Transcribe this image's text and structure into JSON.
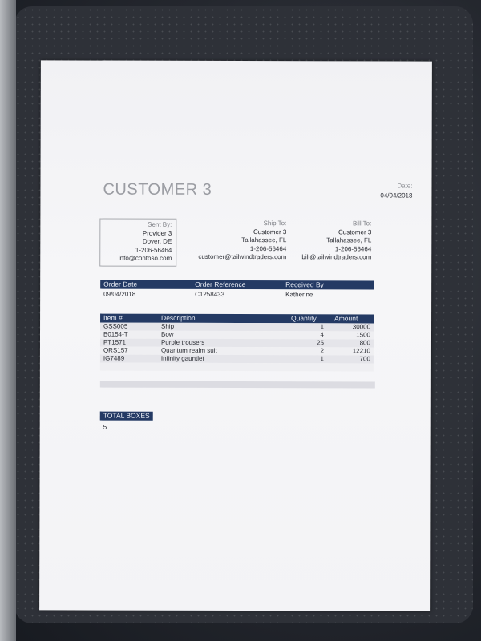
{
  "document": {
    "title": "CUSTOMER 3",
    "date_label": "Date:",
    "date_value": "04/04/2018"
  },
  "sent_by": {
    "label": "Sent By:",
    "name": "Provider 3",
    "city": "Dover, DE",
    "phone": "1-206-56464",
    "email": "info@contoso.com"
  },
  "ship_to": {
    "label": "Ship To:",
    "name": "Customer 3",
    "city": "Tallahassee, FL",
    "phone": "1-206-56464",
    "email": "customer@tailwindtraders.com"
  },
  "bill_to": {
    "label": "Bill To:",
    "name": "Customer 3",
    "city": "Tallahassee, FL",
    "phone": "1-206-56464",
    "email": "bill@tailwindtraders.com"
  },
  "order": {
    "headers": {
      "order_date": "Order Date",
      "order_reference": "Order Reference",
      "received_by": "Received By"
    },
    "values": {
      "order_date": "09/04/2018",
      "order_reference": "C1258433",
      "received_by": "Katherine"
    }
  },
  "items": {
    "headers": {
      "item": "Item #",
      "description": "Description",
      "quantity": "Quantity",
      "amount": "Amount"
    },
    "rows": [
      {
        "item": "GSS005",
        "description": "Ship",
        "quantity": "1",
        "amount": "30000"
      },
      {
        "item": "B0154-T",
        "description": "Bow",
        "quantity": "4",
        "amount": "1500"
      },
      {
        "item": "PT1571",
        "description": "Purple trousers",
        "quantity": "25",
        "amount": "800"
      },
      {
        "item": "QRS157",
        "description": "Quantum realm suit",
        "quantity": "2",
        "amount": "12210"
      },
      {
        "item": "IG7489",
        "description": "Infinity gauntlet",
        "quantity": "1",
        "amount": "700"
      }
    ]
  },
  "total_boxes": {
    "label": "TOTAL BOXES",
    "value": "5"
  },
  "colors": {
    "header_bar": "#243a64",
    "paper": "#f4f4f7",
    "board": "#2e3138"
  }
}
